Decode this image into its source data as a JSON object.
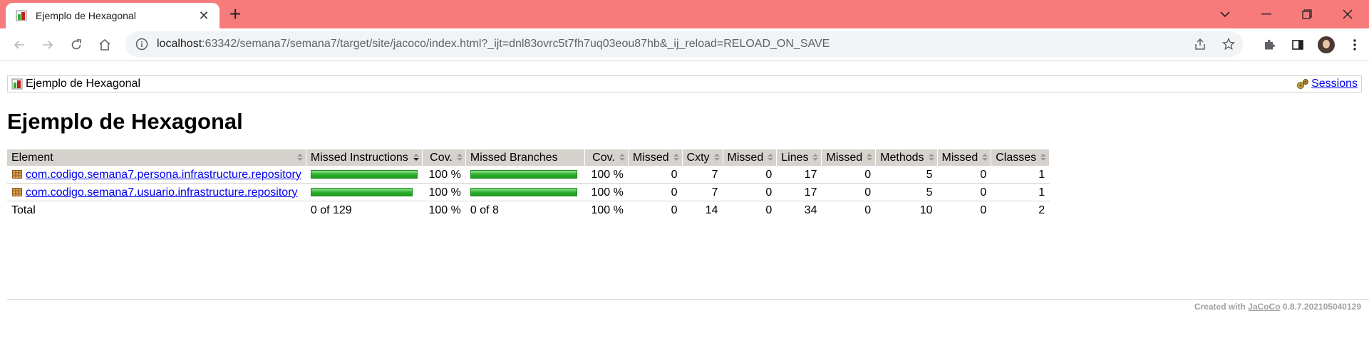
{
  "browser": {
    "tab_title": "Ejemplo de Hexagonal",
    "url_host": "localhost",
    "url_path": ":63342/semana7/semana7/target/site/jacoco/index.html?_ijt=dnl83ovrc5t7fh7uq03eou87hb&_ij_reload=RELOAD_ON_SAVE",
    "accent_color": "#f77b7b"
  },
  "page": {
    "breadcrumb_label": "Ejemplo de Hexagonal",
    "sessions_label": "Sessions",
    "title": "Ejemplo de Hexagonal"
  },
  "table": {
    "headers": [
      "Element",
      "Missed Instructions",
      "Cov.",
      "Missed Branches",
      "Cov.",
      "Missed",
      "Cxty",
      "Missed",
      "Lines",
      "Missed",
      "Methods",
      "Missed",
      "Classes"
    ],
    "rows": [
      {
        "element": "com.codigo.semana7.persona.infrastructure.repository",
        "instr_cov_fraction": 1.0,
        "instr_cov": "100 %",
        "branch_cov_fraction": 1.0,
        "branch_cov": "100 %",
        "missed_cxty": "0",
        "cxty": "7",
        "missed_lines": "0",
        "lines": "17",
        "missed_methods": "0",
        "methods": "5",
        "missed_classes": "0",
        "classes": "1"
      },
      {
        "element": "com.codigo.semana7.usuario.infrastructure.repository",
        "instr_cov_fraction": 1.0,
        "instr_cov": "100 %",
        "branch_cov_fraction": 1.0,
        "branch_cov": "100 %",
        "missed_cxty": "0",
        "cxty": "7",
        "missed_lines": "0",
        "lines": "17",
        "missed_methods": "0",
        "methods": "5",
        "missed_classes": "0",
        "classes": "1"
      }
    ],
    "total": {
      "label": "Total",
      "instr": "0 of 129",
      "instr_cov": "100 %",
      "branch": "0 of 8",
      "branch_cov": "100 %",
      "missed_cxty": "0",
      "cxty": "14",
      "missed_lines": "0",
      "lines": "34",
      "missed_methods": "0",
      "methods": "10",
      "missed_classes": "0",
      "classes": "2"
    }
  },
  "footer": {
    "created_prefix": "Created with ",
    "tool_name": "JaCoCo",
    "version": " 0.8.7.202105040129"
  }
}
